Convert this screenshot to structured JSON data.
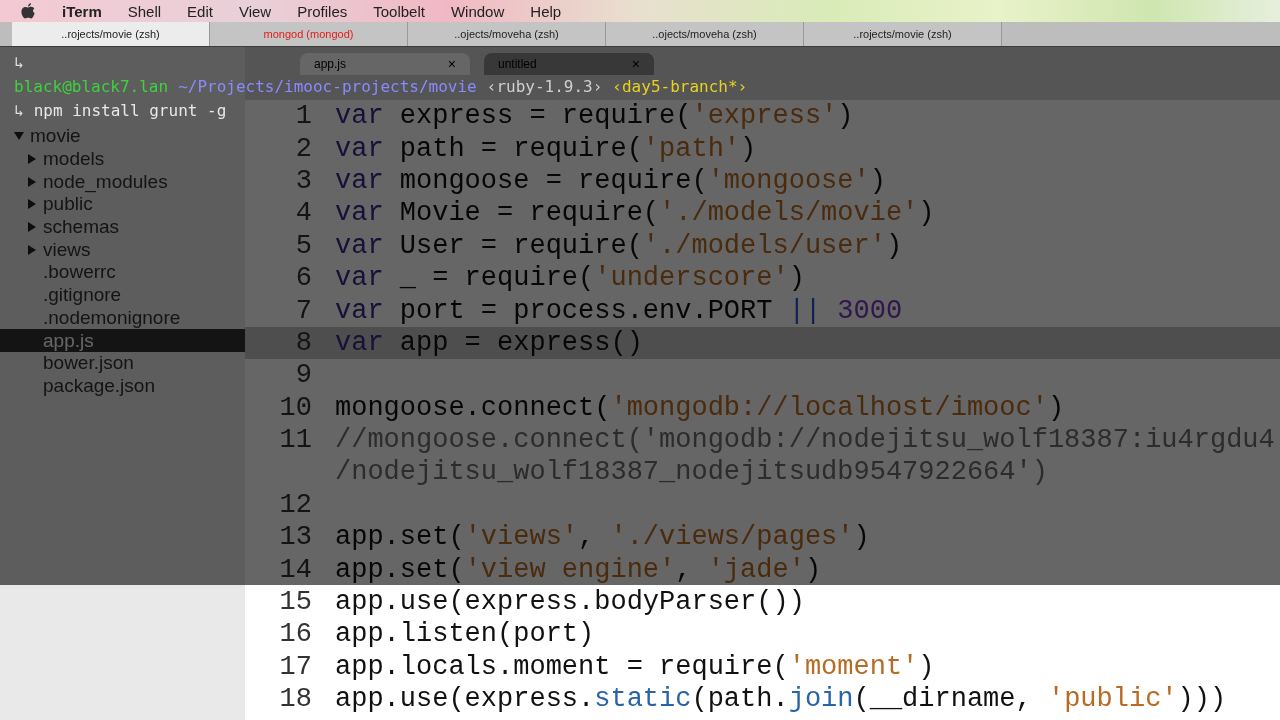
{
  "menu_bar": {
    "items": [
      {
        "label": "iTerm",
        "app": true
      },
      {
        "label": "Shell",
        "app": false
      },
      {
        "label": "Edit",
        "app": false
      },
      {
        "label": "View",
        "app": false
      },
      {
        "label": "Profiles",
        "app": false
      },
      {
        "label": "Toolbelt",
        "app": false
      },
      {
        "label": "Window",
        "app": false
      },
      {
        "label": "Help",
        "app": false
      }
    ]
  },
  "terminal_tabs": [
    {
      "label": "..rojects/movie (zsh)",
      "selected": true,
      "activity": false
    },
    {
      "label": "mongod (mongod)",
      "selected": false,
      "activity": true
    },
    {
      "label": "..ojects/moveha (zsh)",
      "selected": false,
      "activity": false
    },
    {
      "label": "..ojects/moveha (zsh)",
      "selected": false,
      "activity": false
    },
    {
      "label": "..rojects/movie (zsh)",
      "selected": false,
      "activity": false
    }
  ],
  "terminal": {
    "lines": [
      {
        "segments": [
          {
            "kind": "arrow",
            "text": "↳"
          }
        ]
      },
      {
        "segments": [
          {
            "kind": "user",
            "text": "black@black7.lan"
          },
          {
            "kind": "path",
            "text": "~/Projects/imooc-projects/movie"
          },
          {
            "kind": "ruby",
            "text": "‹ruby-1.9.3›"
          },
          {
            "kind": "branch",
            "text": "‹day5-branch*›"
          }
        ]
      },
      {
        "segments": [
          {
            "kind": "arrow",
            "text": "↳"
          },
          {
            "kind": "command",
            "text": "npm install grunt -g"
          }
        ]
      }
    ]
  },
  "sidebar": {
    "tree": [
      {
        "label": "movie",
        "kind": "folder",
        "expanded": true,
        "selected": false,
        "children": [
          {
            "label": "models",
            "kind": "folder",
            "expanded": false,
            "selected": false
          },
          {
            "label": "node_modules",
            "kind": "folder",
            "expanded": false,
            "selected": false
          },
          {
            "label": "public",
            "kind": "folder",
            "expanded": false,
            "selected": false
          },
          {
            "label": "schemas",
            "kind": "folder",
            "expanded": false,
            "selected": false
          },
          {
            "label": "views",
            "kind": "folder",
            "expanded": false,
            "selected": false
          },
          {
            "label": ".bowerrc",
            "kind": "file",
            "selected": false
          },
          {
            "label": ".gitignore",
            "kind": "file",
            "selected": false
          },
          {
            "label": ".nodemonignore",
            "kind": "file",
            "selected": false
          },
          {
            "label": "app.js",
            "kind": "file",
            "selected": true
          },
          {
            "label": "bower.json",
            "kind": "file",
            "selected": false
          },
          {
            "label": "package.json",
            "kind": "file",
            "selected": false
          }
        ]
      }
    ]
  },
  "editor_tabs": [
    {
      "label": "app.js",
      "selected": true,
      "close": "×"
    },
    {
      "label": "untitled",
      "selected": false,
      "close": "×"
    }
  ],
  "code": {
    "lines": [
      {
        "number": "1",
        "current": false,
        "tokens": [
          {
            "kind": "kw",
            "t": "var"
          },
          {
            "kind": "plain",
            "t": " express = require("
          },
          {
            "kind": "str",
            "t": "'express'"
          },
          {
            "kind": "plain",
            "t": ")"
          }
        ]
      },
      {
        "number": "2",
        "current": false,
        "tokens": [
          {
            "kind": "kw",
            "t": "var"
          },
          {
            "kind": "plain",
            "t": " path = require("
          },
          {
            "kind": "str",
            "t": "'path'"
          },
          {
            "kind": "plain",
            "t": ")"
          }
        ]
      },
      {
        "number": "3",
        "current": false,
        "tokens": [
          {
            "kind": "kw",
            "t": "var"
          },
          {
            "kind": "plain",
            "t": " mongoose = require("
          },
          {
            "kind": "str",
            "t": "'mongoose'"
          },
          {
            "kind": "plain",
            "t": ")"
          }
        ]
      },
      {
        "number": "4",
        "current": false,
        "tokens": [
          {
            "kind": "kw",
            "t": "var"
          },
          {
            "kind": "plain",
            "t": " Movie = require("
          },
          {
            "kind": "str",
            "t": "'./models/movie'"
          },
          {
            "kind": "plain",
            "t": ")"
          }
        ]
      },
      {
        "number": "5",
        "current": false,
        "tokens": [
          {
            "kind": "kw",
            "t": "var"
          },
          {
            "kind": "plain",
            "t": " User = require("
          },
          {
            "kind": "str",
            "t": "'./models/user'"
          },
          {
            "kind": "plain",
            "t": ")"
          }
        ]
      },
      {
        "number": "6",
        "current": false,
        "tokens": [
          {
            "kind": "kw",
            "t": "var"
          },
          {
            "kind": "plain",
            "t": " _ = require("
          },
          {
            "kind": "str",
            "t": "'underscore'"
          },
          {
            "kind": "plain",
            "t": ")"
          }
        ]
      },
      {
        "number": "7",
        "current": false,
        "tokens": [
          {
            "kind": "kw",
            "t": "var"
          },
          {
            "kind": "plain",
            "t": " port = process.env.PORT "
          },
          {
            "kind": "op",
            "t": "||"
          },
          {
            "kind": "num",
            "t": " 3000"
          }
        ]
      },
      {
        "number": "8",
        "current": true,
        "tokens": [
          {
            "kind": "kw",
            "t": "var"
          },
          {
            "kind": "plain",
            "t": " app = express()"
          }
        ]
      },
      {
        "number": "9",
        "current": false
      },
      {
        "number": "10",
        "current": false,
        "tokens": [
          {
            "kind": "plain",
            "t": "mongoose.connect("
          },
          {
            "kind": "str",
            "t": "'mongodb://localhost/imooc'"
          },
          {
            "kind": "plain",
            "t": ")"
          }
        ]
      },
      {
        "number": "11",
        "current": false,
        "tokens": [
          {
            "kind": "comment",
            "t": "//mongoose.connect('mongodb://nodejitsu_wolf18387:iu4rgdu4"
          }
        ]
      },
      {
        "current": false,
        "tokens": [
          {
            "kind": "comment",
            "t": "/nodejitsu_wolf18387_nodejitsudb9547922664')"
          }
        ]
      },
      {
        "number": "12",
        "current": false
      },
      {
        "number": "13",
        "current": false,
        "tokens": [
          {
            "kind": "plain",
            "t": "app.set("
          },
          {
            "kind": "str",
            "t": "'views'"
          },
          {
            "kind": "plain",
            "t": ", "
          },
          {
            "kind": "str",
            "t": "'./views/pages'"
          },
          {
            "kind": "plain",
            "t": ")"
          }
        ]
      },
      {
        "number": "14",
        "current": false,
        "tokens": [
          {
            "kind": "plain",
            "t": "app.set("
          },
          {
            "kind": "str",
            "t": "'view engine'"
          },
          {
            "kind": "plain",
            "t": ", "
          },
          {
            "kind": "str",
            "t": "'jade'"
          },
          {
            "kind": "plain",
            "t": ")"
          }
        ]
      },
      {
        "number": "15",
        "current": false,
        "tokens": [
          {
            "kind": "plain",
            "t": "app.use(express.bodyParser())"
          }
        ]
      },
      {
        "number": "16",
        "current": false,
        "tokens": [
          {
            "kind": "plain",
            "t": "app.listen(port)"
          }
        ]
      },
      {
        "number": "17",
        "current": false,
        "tokens": [
          {
            "kind": "plain",
            "t": "app.locals.moment = require("
          },
          {
            "kind": "str",
            "t": "'moment'"
          },
          {
            "kind": "plain",
            "t": ")"
          }
        ]
      },
      {
        "number": "18",
        "current": false,
        "tokens": [
          {
            "kind": "plain",
            "t": "app.use(express."
          },
          {
            "kind": "fn",
            "t": "static"
          },
          {
            "kind": "plain",
            "t": "(path."
          },
          {
            "kind": "fn",
            "t": "join"
          },
          {
            "kind": "plain",
            "t": "(__dirname, "
          },
          {
            "kind": "str",
            "t": "'public'"
          },
          {
            "kind": "plain",
            "t": ")))"
          }
        ]
      }
    ]
  }
}
